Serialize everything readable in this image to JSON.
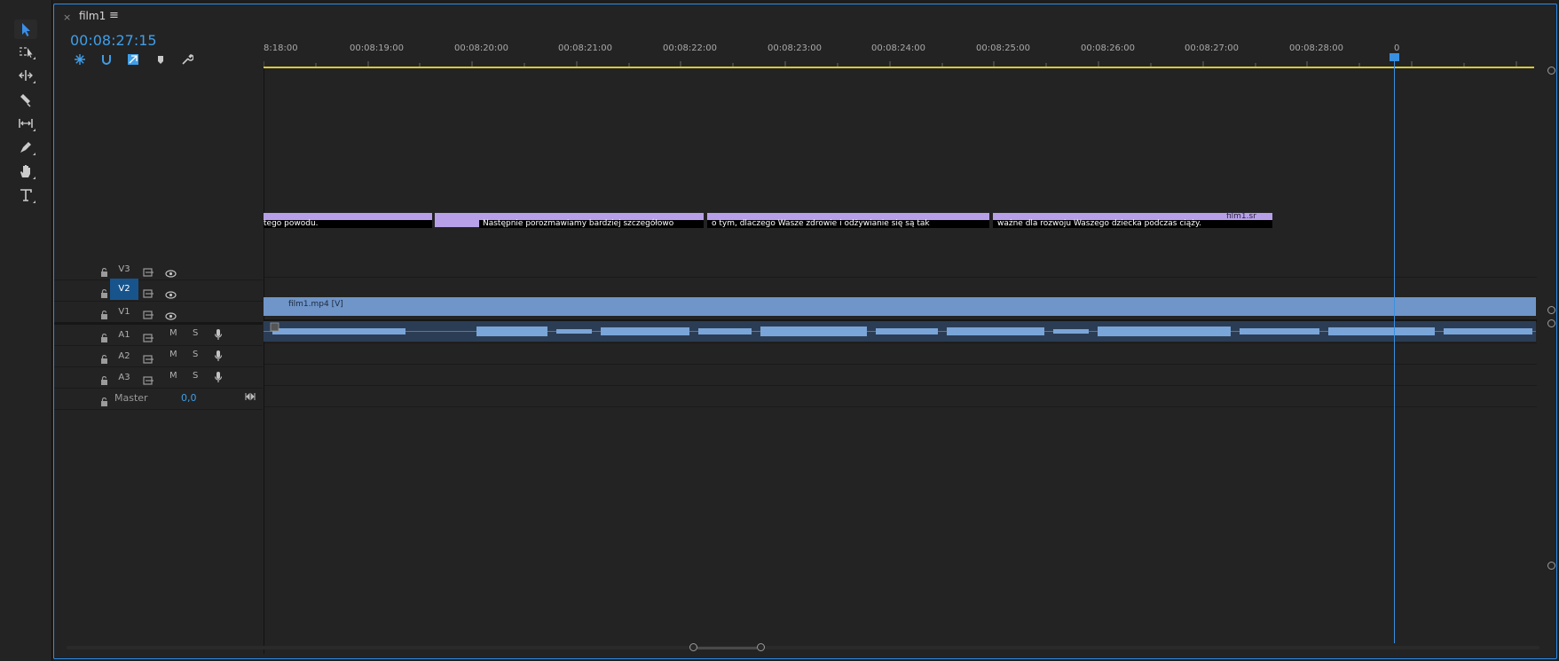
{
  "tab": {
    "title": "film1",
    "close": "×",
    "menu": "≡"
  },
  "timecode": "00:08:27:15",
  "ruler": {
    "labels": [
      "8:18:00",
      "00:08:19:00",
      "00:08:20:00",
      "00:08:21:00",
      "00:08:22:00",
      "00:08:23:00",
      "00:08:24:00",
      "00:08:25:00",
      "00:08:26:00",
      "00:08:27:00",
      "00:08:28:00",
      "0"
    ]
  },
  "tracks": [
    {
      "name": "V3",
      "targeted": false
    },
    {
      "name": "V2",
      "targeted": true
    },
    {
      "name": "V1",
      "targeted": false
    },
    {
      "name": "A1",
      "m": "M",
      "s": "S"
    },
    {
      "name": "A2",
      "m": "M",
      "s": "S"
    },
    {
      "name": "A3",
      "m": "M",
      "s": "S"
    }
  ],
  "master": {
    "label": "Master",
    "value": "0,0"
  },
  "subtitles": [
    {
      "text": "tego powodu."
    },
    {
      "text": "Następnie porozmawiamy bardziej szczegółowo"
    },
    {
      "text": "o tym, dlaczego Wasze zdrowie i odżywianie się są tak"
    },
    {
      "text": "ważne dla rozwoju Waszego dziecka podczas ciąży."
    },
    {
      "text": "film1.sr"
    }
  ],
  "video_clip": {
    "label": "film1.mp4 [V]"
  },
  "playhead_time": "00:08:27:15",
  "colors": {
    "accent": "#2d8ceb",
    "timecode": "#3f9ee8",
    "subtitle": "#b7a0e8",
    "video": "#6f95c9",
    "audio": "#2b3d55",
    "work_area": "#d9c735"
  }
}
